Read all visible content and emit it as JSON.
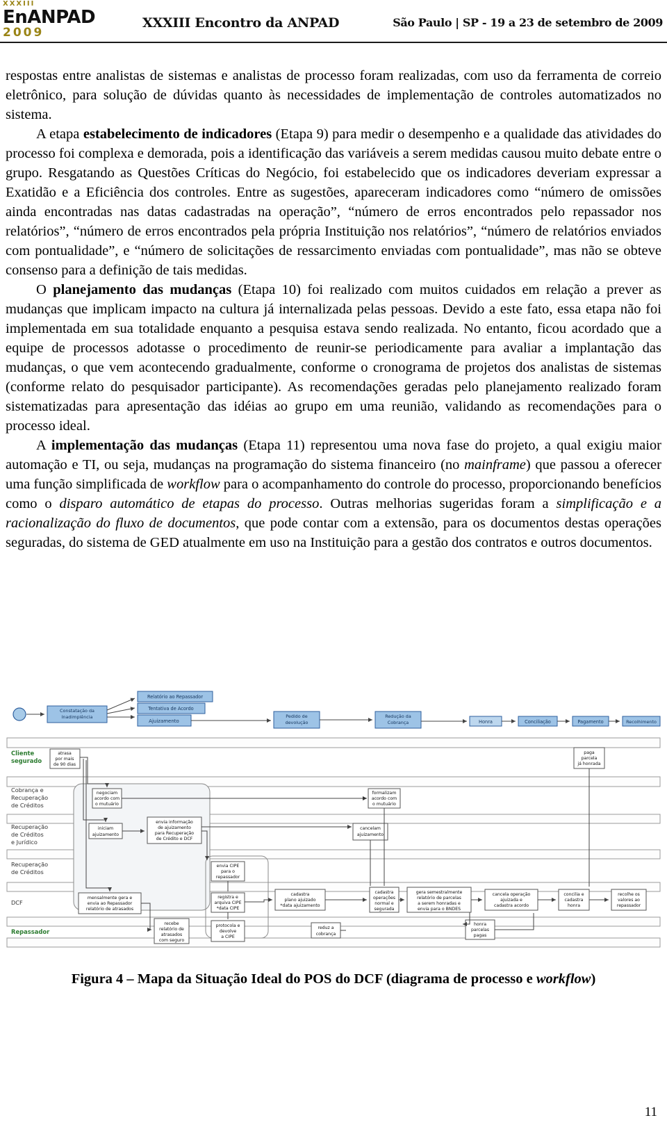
{
  "header": {
    "logo_roman": "XXXIII",
    "logo_name": "EnANPAD",
    "logo_year": "2009",
    "event_title": "XXXIII Encontro da ANPAD",
    "event_place_date": "São Paulo | SP - 19 a 23 de setembro de 2009"
  },
  "body": {
    "para1": "respostas entre analistas de sistemas e analistas de processo foram realizadas, com uso da ferramenta de correio eletrônico, para solução de dúvidas quanto às necessidades de implementação de controles automatizados no sistema.",
    "para2_a": "A etapa ",
    "para2_bold": "estabelecimento de indicadores",
    "para2_b": " (Etapa 9) para medir o desempenho e a qualidade das atividades do processo foi complexa e demorada, pois a identificação das variáveis a serem medidas causou muito debate entre o grupo. Resgatando as Questões Críticas do Negócio, foi estabelecido que os indicadores deveriam expressar a Exatidão e a Eficiência dos controles. Entre as sugestões, apareceram indicadores como “número de omissões ainda encontradas nas datas cadastradas na operação”, “número de erros encontrados pelo repassador nos relatórios”, “número de erros encontrados pela própria Instituição nos relatórios”, “número de relatórios enviados com pontualidade”, e “número de solicitações de ressarcimento enviadas com pontualidade”, mas não se obteve consenso para a definição de tais medidas.",
    "para3_a": "O ",
    "para3_bold": "planejamento das mudanças",
    "para3_b": " (Etapa 10) foi realizado com muitos cuidados em relação a prever as mudanças que implicam impacto na cultura já internalizada pelas pessoas. Devido a este fato, essa etapa não foi implementada em sua totalidade enquanto a pesquisa estava sendo realizada. No entanto, ficou acordado que a equipe de processos adotasse o procedimento de reunir-se periodicamente para avaliar a implantação das mudanças, o que vem acontecendo gradualmente, conforme o cronograma de projetos dos analistas de sistemas (conforme relato do pesquisador participante). As recomendações geradas pelo planejamento realizado foram sistematizadas para apresentação das idéias ao grupo em uma reunião, validando as recomendações para o processo ideal.",
    "para4_a": "A ",
    "para4_bold": "implementação das mudanças",
    "para4_b": " (Etapa 11) representou uma nova fase do projeto, a qual exigiu maior automação e TI, ou seja, mudanças na programação do sistema financeiro (no ",
    "para4_i1": "mainframe",
    "para4_c": ") que passou a oferecer uma função simplificada de ",
    "para4_i2": "workflow",
    "para4_d": " para o acompanhamento do controle do processo, proporcionando benefícios como o ",
    "para4_i3": "disparo automático de etapas do processo",
    "para4_e": ". Outras melhorias sugeridas foram a ",
    "para4_i4": "simplificação e a racionalização do fluxo de documentos",
    "para4_f": ", que pode contar com a extensão, para os documentos destas operações seguradas, do sistema de GED atualmente em uso na Instituição para a gestão dos contratos e outros documentos."
  },
  "figure": {
    "caption_a": "Figura 4 – Mapa da Situação Ideal do POS do DCF (diagrama de processo e ",
    "caption_i": "workflow",
    "caption_b": ")",
    "colors": {
      "blue_fill": "#9dc3e6",
      "blue_fill_light": "#bdd7ee",
      "blue_stroke": "#2e5f9e",
      "lane_label_green": "#2e7d32",
      "lane_label_gray": "#333333",
      "box_stroke": "#555555",
      "lane_line": "#999999",
      "arrow": "#555555"
    },
    "top_chain": [
      {
        "label": "Constatação da\nInadimplência"
      },
      {
        "label": "Relatório ao Repassador"
      },
      {
        "label": "Tentativa de Acordo"
      },
      {
        "label": "Ajuizamento"
      },
      {
        "label": "Pedido de\ndevolução"
      },
      {
        "label": "Redução da\nCobrança"
      },
      {
        "label": "Honra"
      },
      {
        "label": "Conciliação"
      },
      {
        "label": "Pagamento"
      },
      {
        "label": "Recolhimento"
      }
    ],
    "lanes": [
      {
        "label": "Cliente\nsegurado",
        "style": "green"
      },
      {
        "label": "Cobrança e\nRecuperação\nde Créditos",
        "style": "gray"
      },
      {
        "label": "Recuperação\nde Créditos\ne Jurídico",
        "style": "gray"
      },
      {
        "label": "Recuperação\nde Créditos",
        "style": "gray"
      },
      {
        "label": "DCF",
        "style": "gray"
      },
      {
        "label": "Repassador",
        "style": "green"
      }
    ],
    "tasks": [
      {
        "label": "atrasa\npor mais\nde 90 dias"
      },
      {
        "label": "negociam\nacordo com\no mutuário"
      },
      {
        "label": "formalizam\nacordo com\no mutuário"
      },
      {
        "label": "iniciam\najuizamento"
      },
      {
        "label": "envia informação\nde ajuizamento\npara Recuperação\nde Crédito e DCF"
      },
      {
        "label": "cancelam\najuizamento"
      },
      {
        "label": "envia CIPE\npara o\nrepassador"
      },
      {
        "label": "mensalmente gera e\nenvia ao Repassador\nrelatório de atrasados"
      },
      {
        "label": "registra e\narquiva CIPE\n*data CIPE"
      },
      {
        "label": "cadastra\nplano ajuizado\n*data ajuizamento"
      },
      {
        "label": "cadastra\noperações\nnormal e\nsegurada"
      },
      {
        "label": "gera semestralmente\nrelatório de parcelas\na serem honradas e\nenvia para o BNDES"
      },
      {
        "label": "cancela operação\najuizada e\ncadastra acordo"
      },
      {
        "label": "concilia e\ncadastra\nhonra"
      },
      {
        "label": "recolhe os\nvalores ao\nrepassador"
      },
      {
        "label": "paga\nparcela\njá honrada"
      },
      {
        "label": "recebe\nrelatório de\natrasados\ncom seguro"
      },
      {
        "label": "protocola e\ndevolve\na CIPE"
      },
      {
        "label": "reduz a\ncobrança"
      },
      {
        "label": "honra\nparcelas\npagas"
      }
    ]
  },
  "page_number": "11"
}
